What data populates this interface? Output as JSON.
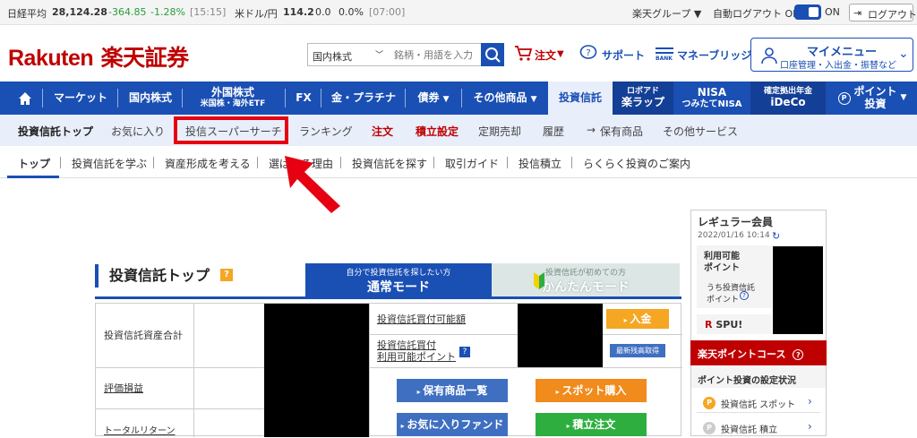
{
  "ticker": {
    "nikkei_label": "日経平均",
    "nikkei_value": "28,124.28",
    "nikkei_change": "-364.85",
    "nikkei_pct": "-1.28%",
    "nikkei_time": "[15:15]",
    "usdjpy_label": "米ドル/円",
    "usdjpy_value": "114.2",
    "usdjpy_change": "0.0",
    "usdjpy_pct": "0.0%",
    "usdjpy_time": "[07:00]",
    "group_label": "楽天グループ ▼",
    "autologout_label": "自動ログアウト OFF",
    "autologout_state": "ON",
    "logout_label": "ログアウト"
  },
  "header": {
    "logo_latin": "Rakuten",
    "logo_kanji": "楽天証券",
    "search_category": "国内株式",
    "search_placeholder": "銘柄・用語を入力",
    "order_label": "注文",
    "support_label": "サポート",
    "bridge_label": "マネーブリッジ",
    "bank_label": "BANK",
    "mymenu_title": "マイメニュー",
    "mymenu_sub": "口座管理・入出金・振替など"
  },
  "mainnav": {
    "items": [
      {
        "label": "マーケット"
      },
      {
        "label": "国内株式"
      },
      {
        "label": "外国株式",
        "sub": "米国株・海外ETF"
      },
      {
        "label": "FX"
      },
      {
        "label": "金・プラチナ"
      },
      {
        "label": "債券"
      },
      {
        "label": "その他商品"
      },
      {
        "label": "投資信託"
      },
      {
        "label": "ロボアド",
        "sub": "楽ラップ"
      },
      {
        "label": "NISA",
        "sub": "つみたてNISA"
      },
      {
        "label": "確定拠出年金",
        "sub": "iDeCo"
      },
      {
        "label": "ポイント",
        "sub": "投資"
      }
    ]
  },
  "subnav": {
    "items": [
      "投資信託トップ",
      "お気に入り",
      "投信スーパーサーチ",
      "ランキング",
      "注文",
      "積立設定",
      "定期売却",
      "履歴",
      "保有商品",
      "その他サービス"
    ]
  },
  "thirdnav": {
    "items": [
      "トップ",
      "投資信託を学ぶ",
      "資産形成を考える",
      "選ばれる理由",
      "投資信託を探す",
      "取引ガイド",
      "投信積立",
      "らくらく投資のご案内"
    ]
  },
  "content": {
    "title": "投資信託トップ",
    "help": "?",
    "mode_normal_small": "自分で投資信託を探したい方",
    "mode_normal": "通常モード",
    "mode_easy_small": "投資信託が初めての方",
    "mode_easy": "かんたんモード",
    "row_total_assets": "投資信託資産合計",
    "row_pl": "評価損益",
    "row_total_return": "トータルリターン",
    "buy_capacity": "投資信託買付可能額",
    "buy_points_line1": "投資信託買付",
    "buy_points_line2": "利用可能ポイント",
    "deposit_button": "入金",
    "refresh_button": "最新残高取得",
    "holdings_button": "保有商品一覧",
    "spot_button": "スポット購入",
    "favorite_button": "お気に入りファンド",
    "tsumitate_button": "積立注文"
  },
  "rpanel": {
    "member": "レギュラー会員",
    "datetime": "2022/01/16 10:14",
    "points_label1": "利用可能",
    "points_label2": "ポイント",
    "invest_points1": "うち投資信託",
    "invest_points2": "ポイント",
    "spu": "SPU!",
    "course": "楽天ポイントコース",
    "settings": "ポイント投資の設定状況",
    "spot_item": "投資信託 スポット",
    "tsumitate_item": "投資信託 積立"
  },
  "colors": {
    "brand_red": "#bf0000",
    "nav_blue": "#1a4fb4",
    "highlight_red": "#e60012"
  }
}
